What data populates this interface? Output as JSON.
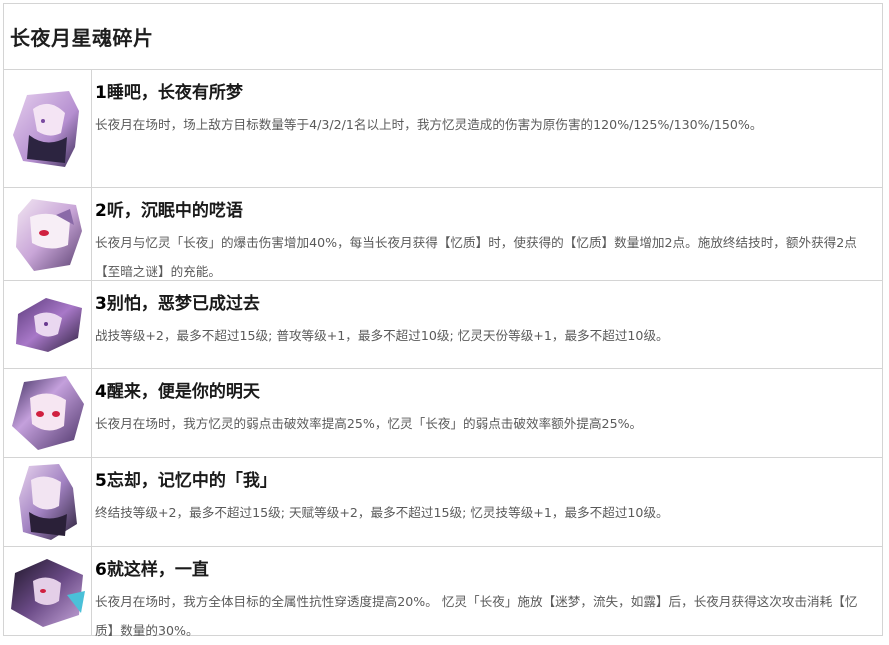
{
  "page": {
    "title": "长夜月星魂碎片"
  },
  "eidolons": [
    {
      "number": "1",
      "name": "睡吧，长夜有所梦",
      "description": "长夜月在场时，场上敌方目标数量等于4/3/2/1名以上时，我方忆灵造成的伤害为原伤害的120%/125%/130%/150%。"
    },
    {
      "number": "2",
      "name": "听，沉眠中的呓语",
      "description": "长夜月与忆灵「长夜」的爆击伤害增加40%，每当长夜月获得【忆质】时，使获得的【忆质】数量增加2点。施放终结技时，额外获得2点【至暗之谜】的充能。"
    },
    {
      "number": "3",
      "name": "别怕，恶梦已成过去",
      "description": "战技等级+2，最多不超过15级; 普攻等级+1，最多不超过10级; 忆灵天份等级+1，最多不超过10级。"
    },
    {
      "number": "4",
      "name": "醒来，便是你的明天",
      "description": "长夜月在场时，我方忆灵的弱点击破效率提高25%，忆灵「长夜」的弱点击破效率额外提高25%。"
    },
    {
      "number": "5",
      "name": "忘却，记忆中的「我」",
      "description": "终结技等级+2，最多不超过15级; 天赋等级+2，最多不超过15级; 忆灵技等级+1，最多不超过10级。"
    },
    {
      "number": "6",
      "name": "就这样，一直",
      "description": "长夜月在场时，我方全体目标的全属性抗性穿透度提高20%。 忆灵「长夜」施放【迷梦，流失，如露】后，长夜月获得这次攻击消耗【忆质】数量的30%。"
    }
  ],
  "colors": {
    "border": "#d4d4d4",
    "title_text": "#1e1e1e",
    "desc_text": "#5a5a5a",
    "art_purple": "#b58fd0",
    "art_dark": "#2c2440",
    "art_eye_red": "#d02040"
  },
  "icons": [
    "eidolon-portrait-icon"
  ]
}
